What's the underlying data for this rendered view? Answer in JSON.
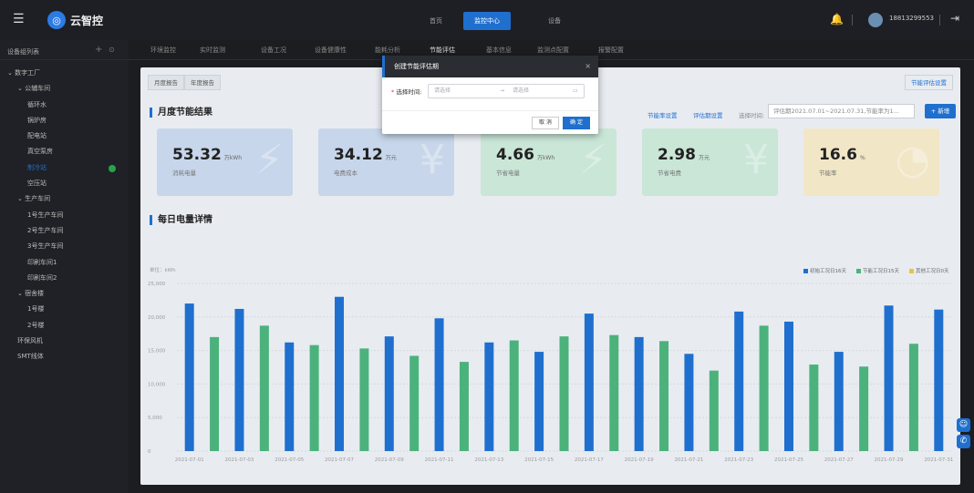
{
  "topbar": {
    "app_name": "云智控",
    "nav": [
      "首页",
      "监控中心",
      "设备"
    ],
    "nav_active": 1,
    "user": "18813299553"
  },
  "sidebar": {
    "title": "设备组列表",
    "add_icon": "plus-icon",
    "info_icon": "info-icon",
    "tree": [
      {
        "label": "数字工厂",
        "level": 0,
        "expand": true
      },
      {
        "label": "公辅车间",
        "level": 1,
        "expand": true
      },
      {
        "label": "循环水",
        "level": 2
      },
      {
        "label": "锅炉房",
        "level": 2
      },
      {
        "label": "配电站",
        "level": 2
      },
      {
        "label": "真空泵房",
        "level": 2
      },
      {
        "label": "制冷站",
        "level": 2,
        "selected": true,
        "status": true
      },
      {
        "label": "空压站",
        "level": 2
      },
      {
        "label": "生产车间",
        "level": 1,
        "expand": true
      },
      {
        "label": "1号生产车间",
        "level": 2
      },
      {
        "label": "2号生产车间",
        "level": 2
      },
      {
        "label": "3号生产车间",
        "level": 2
      },
      {
        "label": "印刷车间1",
        "level": 2
      },
      {
        "label": "印刷车间2",
        "level": 2
      },
      {
        "label": "宿舍楼",
        "level": 1,
        "expand": true
      },
      {
        "label": "1号楼",
        "level": 2
      },
      {
        "label": "2号楼",
        "level": 2
      },
      {
        "label": "环保风机",
        "level": 1
      },
      {
        "label": "SMT线体",
        "level": 1
      }
    ]
  },
  "tabs": [
    "环境监控",
    "实时监测",
    "设备工况",
    "设备健康性",
    "能耗分析",
    "节能评估",
    "基本信息",
    "监测点配置",
    "报警配置"
  ],
  "tab_active": 5,
  "report_tabs": [
    "月度报告",
    "年度报告"
  ],
  "settings_tab": "节能评估设置",
  "section1_title": "月度节能结果",
  "toolbar": {
    "rate_setting": "节能率设置",
    "period_setting": "评估期设置",
    "select_label": "选择时间:",
    "select_value": "评估期2021.07.01~2021.07.31,节能率为1...",
    "new_button": "+ 新增"
  },
  "cards": [
    {
      "value": "53.32",
      "unit": "万kWh",
      "label": "消耗电量",
      "color": "#c7d6ea",
      "icon": "lightning-icon"
    },
    {
      "value": "34.12",
      "unit": "万元",
      "label": "电费成本",
      "color": "#c7d6ea",
      "icon": "yuan-icon"
    },
    {
      "value": "4.66",
      "unit": "万kWh",
      "label": "节省电量",
      "color": "#c9e6d7",
      "icon": "lightning-icon"
    },
    {
      "value": "2.98",
      "unit": "万元",
      "label": "节省电费",
      "color": "#c9e6d7",
      "icon": "yuan-icon"
    },
    {
      "value": "16.6",
      "unit": "%",
      "label": "节能率",
      "color": "#f1e6c6",
      "icon": "pie-icon"
    }
  ],
  "section2_title": "每日电量详情",
  "chart_unit": "单位：kWh",
  "legend": [
    {
      "label": "初始工况日16天",
      "color": "#1f6fcf"
    },
    {
      "label": "节能工况日15天",
      "color": "#4bb27c"
    },
    {
      "label": "其他工况日0天",
      "color": "#f0c040"
    }
  ],
  "chart_data": {
    "type": "bar",
    "yticks": [
      "0",
      "5,000",
      "10,000",
      "15,000",
      "20,000",
      "25,000"
    ],
    "ylim": [
      0,
      25000
    ],
    "xticks": [
      "2021-07-01",
      "2021-07-03",
      "2021-07-05",
      "2021-07-07",
      "2021-07-09",
      "2021-07-11",
      "2021-07-13",
      "2021-07-15",
      "2021-07-17",
      "2021-07-19",
      "2021-07-21",
      "2021-07-23",
      "2021-07-25",
      "2021-07-27",
      "2021-07-29",
      "2021-07-31"
    ],
    "values": [
      22000,
      17000,
      21200,
      18700,
      16200,
      15800,
      23000,
      15300,
      17100,
      14200,
      19800,
      13300,
      16200,
      16500,
      14800,
      17100,
      20500,
      17300,
      17000,
      16400,
      14500,
      12000,
      20800,
      18700,
      19300,
      12900,
      14800,
      12600,
      21700,
      16000,
      21100
    ],
    "series_type": [
      "init",
      "save",
      "init",
      "save",
      "init",
      "save",
      "init",
      "save",
      "init",
      "save",
      "init",
      "save",
      "init",
      "save",
      "init",
      "save",
      "init",
      "save",
      "init",
      "save",
      "init",
      "save",
      "init",
      "save",
      "init",
      "save",
      "init",
      "save",
      "init",
      "save",
      "init"
    ]
  },
  "modal": {
    "title": "创建节能评估期",
    "close": "×",
    "field_label": "选择时间:",
    "start_placeholder": "请选择",
    "arrow": "→",
    "end_placeholder": "请选择",
    "cancel": "取 消",
    "ok": "确 定"
  }
}
